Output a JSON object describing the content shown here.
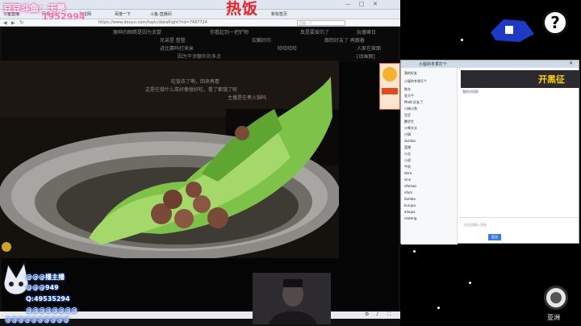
{
  "overlay": {
    "top_left_text": "豆豆斗鱼：于是",
    "top_left_number": "1952994",
    "hot_title": "热饭"
  },
  "browser": {
    "tabs": [
      "斗鱼直播",
      "网易新闻",
      "淘宝网",
      "百度一下",
      "斗鱼-直播间",
      "新标签页"
    ],
    "address": "https://www.douyu.com/topic/dataRight?rid=7487724",
    "search_placeholder": "百度一下"
  },
  "danmaku": [
    "魔神的眼睛是因为贪婪",
    "你看起到一把铲物",
    "真是要爱的了",
    "玩播嘛日",
    "兄弟是 整整",
    "宏麟好的",
    "跟踪好友了 再跟着",
    "进比赛吗打来米",
    "哈哈哈哈",
    "人家在家面",
    "因为干涉额外的多点",
    "[动画图]",
    "吃饭去了啊，回来再看",
    "这是在做什么菜好像很好吃，看了都饿了呢",
    "主播是在煮火锅吗"
  ],
  "qq": {
    "group_title": "小屋的冬季打个",
    "list_items": [
      "我的好友",
      "小屋的冬季打个",
      "陈东",
      "金大牛",
      "Mo的 好友了",
      "小杨小鱼",
      "豆豆",
      "鹏学生",
      "火柴头头",
      "小锅",
      "dumbo",
      "蓝猪",
      "小吉",
      "小虎",
      "牛奶",
      "dora",
      "sinx",
      "xfxmao",
      "xfxm",
      "dumbo",
      "kurupa",
      "aloupa",
      "niuteng"
    ],
    "banner_text": "开黑征",
    "chat_preview": "我的对话框",
    "input_hint": "在这里输入消息",
    "send_label": "发送"
  },
  "streamer": {
    "lines": [
      "@@@播主播",
      "@@@949",
      "Q:49535294",
      "@@@@@@@@",
      "@@@@@@@@@@"
    ]
  },
  "right": {
    "help_label": "?",
    "region_label": "亚洲"
  },
  "colors": {
    "accent": "#e62129",
    "glow": "#2a6cff",
    "banner": "#ffd400"
  }
}
